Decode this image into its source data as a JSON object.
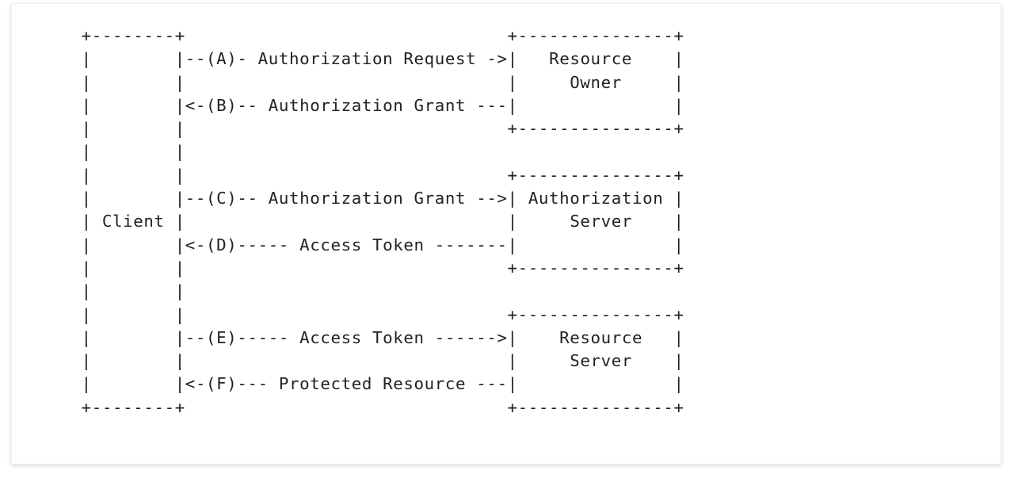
{
  "diagram": {
    "actors": {
      "client": "Client",
      "resource_owner_l1": "Resource",
      "resource_owner_l2": "Owner",
      "auth_server_l1": "Authorization",
      "auth_server_l2": "Server",
      "resource_server_l1": "Resource",
      "resource_server_l2": "Server"
    },
    "flows": {
      "A": "Authorization Request",
      "B": "Authorization Grant",
      "C": "Authorization Grant",
      "D": "Access Token",
      "E": "Access Token",
      "F": "Protected Resource"
    }
  }
}
